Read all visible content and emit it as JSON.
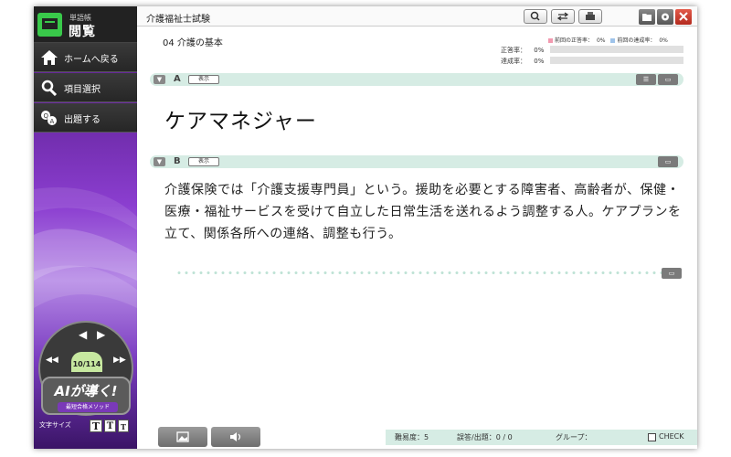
{
  "sidebar": {
    "logo_small": "単語帳",
    "logo_title": "閲覧",
    "nav": [
      {
        "label": "ホームへ戻る",
        "icon": "home-icon"
      },
      {
        "label": "項目選択",
        "icon": "magnifier-icon"
      },
      {
        "label": "出題する",
        "icon": "qa-icon"
      }
    ],
    "counter": "10/114",
    "ai_title": "AIが導く!",
    "ai_sub": "最短合格メソッド",
    "font_size_label": "文字サイズ",
    "font_buttons": [
      "T",
      "T",
      "T"
    ]
  },
  "header": {
    "title": "介護福祉士試験",
    "buttons": [
      "search-icon",
      "swap-icon",
      "print-icon"
    ],
    "window_buttons": [
      "folder-icon",
      "gear-icon",
      "close-icon"
    ]
  },
  "card": {
    "section": "04 介護の基本",
    "legend_prev_correct": "前回の正答率：",
    "legend_prev_correct_val": "0%",
    "legend_prev_achieve": "前回の達成率：",
    "legend_prev_achieve_val": "0%",
    "correct_label": "正答率：",
    "correct_val": "0%",
    "achieve_label": "達成率：",
    "achieve_val": "0%",
    "band_a_letter": "A",
    "band_b_letter": "B",
    "show_label": "表示",
    "answer": "ケアマネジャー",
    "description": "介護保険では「介護支援専門員」という。援助を必要とする障害者、高齢者が、保健・医療・福祉サービスを受けて自立した日常生活を送れるよう調整する人。ケアプランを立て、関係各所への連絡、調整も行う。"
  },
  "status": {
    "difficulty": "難易度：5",
    "mistakes": "誤答/出題：0 / 0",
    "group": "グループ：",
    "check": "CHECK"
  },
  "colors": {
    "accent_band": "#d6ece4",
    "sidebar_purple": "#7a3cc0",
    "logo_green": "#39c94a",
    "close_red": "#c9392b"
  }
}
